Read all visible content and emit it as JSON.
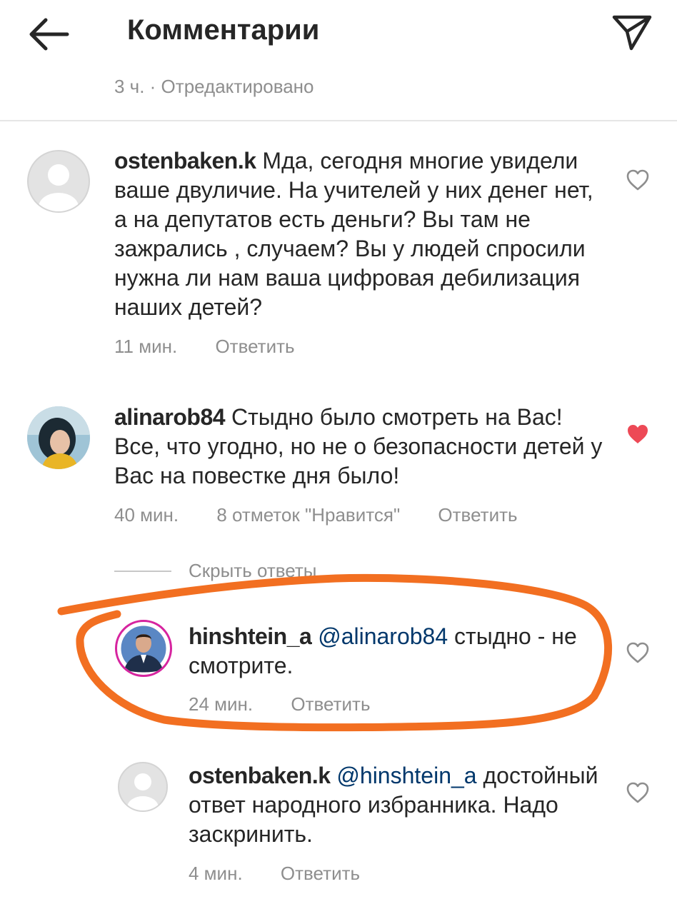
{
  "header": {
    "title": "Комментарии",
    "back_icon": "arrow-left-icon",
    "send_icon": "paper-plane-icon"
  },
  "post_meta": "3 ч. · Отредактировано",
  "comments": [
    {
      "username": "ostenbaken.k",
      "text": "Мда, сегодня многие увидели ваше двуличие. На учителей у них денег нет, а на депутатов есть деньги? Вы там не зажрались , случаем? Вы у людей спросили нужна ли нам ваша цифровая дебилизация наших детей?",
      "time": "11 мин.",
      "reply": "Ответить",
      "liked": false
    },
    {
      "username": "alinarob84",
      "text": "Стыдно было смотреть на Вас! Все, что угодно, но не о безопасности детей у Вас на повестке дня было!",
      "time": "40 мин.",
      "likes": "8 отметок \"Нравится\"",
      "reply": "Ответить",
      "liked": true,
      "hide_replies": "Скрыть ответы"
    }
  ],
  "replies": [
    {
      "username": "hinshtein_a",
      "mention": "@alinarob84",
      "text": "стыдно - не смотрите.",
      "time": "24 мин.",
      "reply": "Ответить",
      "liked": false,
      "highlighted": true
    },
    {
      "username": "ostenbaken.k",
      "mention": "@hinshtein_a",
      "text": "достойный ответ народного избранника. Надо заскринить.",
      "time": "4 мин.",
      "reply": "Ответить",
      "liked": false
    }
  ],
  "colors": {
    "text": "#262626",
    "secondary": "#8e8e8e",
    "mention": "#00376b",
    "like_red": "#ed4956",
    "annotation_orange": "#f26f21"
  }
}
